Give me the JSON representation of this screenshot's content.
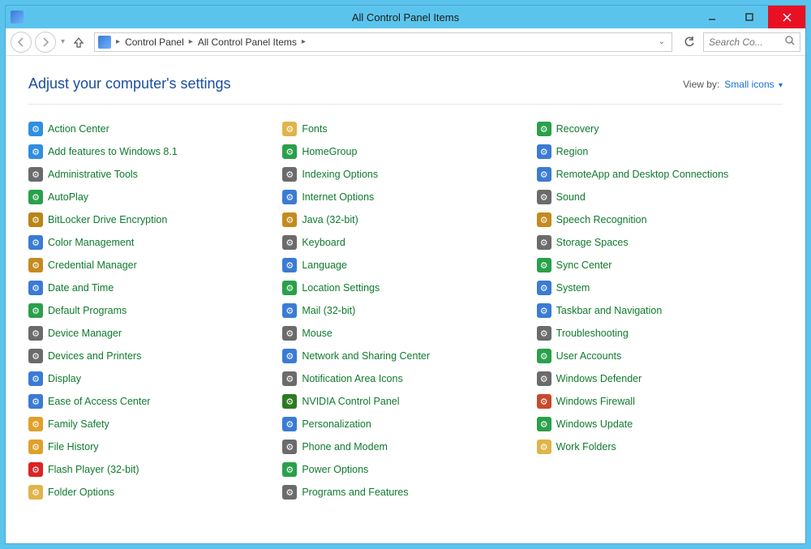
{
  "window": {
    "title": "All Control Panel Items"
  },
  "nav": {
    "breadcrumb": [
      "Control Panel",
      "All Control Panel Items"
    ],
    "search_placeholder": "Search Co..."
  },
  "header": {
    "subtitle": "Adjust your computer's settings",
    "viewby_label": "View by:",
    "viewby_value": "Small icons"
  },
  "items": [
    {
      "label": "Action Center",
      "icon": "flag-icon",
      "bg": "#2f8fe0"
    },
    {
      "label": "Add features to Windows 8.1",
      "icon": "windows-icon",
      "bg": "#2f8fe0"
    },
    {
      "label": "Administrative Tools",
      "icon": "tools-icon",
      "bg": "#6b6b6b"
    },
    {
      "label": "AutoPlay",
      "icon": "autoplay-icon",
      "bg": "#2aa04a"
    },
    {
      "label": "BitLocker Drive Encryption",
      "icon": "lock-icon",
      "bg": "#b88516"
    },
    {
      "label": "Color Management",
      "icon": "color-icon",
      "bg": "#3a7bd5"
    },
    {
      "label": "Credential Manager",
      "icon": "safe-icon",
      "bg": "#c58a1e"
    },
    {
      "label": "Date and Time",
      "icon": "clock-icon",
      "bg": "#3a7bd5"
    },
    {
      "label": "Default Programs",
      "icon": "defaults-icon",
      "bg": "#2aa04a"
    },
    {
      "label": "Device Manager",
      "icon": "device-icon",
      "bg": "#6b6b6b"
    },
    {
      "label": "Devices and Printers",
      "icon": "printer-icon",
      "bg": "#6b6b6b"
    },
    {
      "label": "Display",
      "icon": "display-icon",
      "bg": "#3a7bd5"
    },
    {
      "label": "Ease of Access Center",
      "icon": "ease-icon",
      "bg": "#3a7bd5"
    },
    {
      "label": "Family Safety",
      "icon": "family-icon",
      "bg": "#e0a02a"
    },
    {
      "label": "File History",
      "icon": "history-icon",
      "bg": "#e0a02a"
    },
    {
      "label": "Flash Player (32-bit)",
      "icon": "flash-icon",
      "bg": "#d22"
    },
    {
      "label": "Folder Options",
      "icon": "folder-icon",
      "bg": "#e0b44a"
    },
    {
      "label": "Fonts",
      "icon": "fonts-icon",
      "bg": "#e0b44a"
    },
    {
      "label": "HomeGroup",
      "icon": "homegroup-icon",
      "bg": "#2aa04a"
    },
    {
      "label": "Indexing Options",
      "icon": "index-icon",
      "bg": "#6b6b6b"
    },
    {
      "label": "Internet Options",
      "icon": "internet-icon",
      "bg": "#3a7bd5"
    },
    {
      "label": "Java (32-bit)",
      "icon": "java-icon",
      "bg": "#c58a1e"
    },
    {
      "label": "Keyboard",
      "icon": "keyboard-icon",
      "bg": "#6b6b6b"
    },
    {
      "label": "Language",
      "icon": "language-icon",
      "bg": "#3a7bd5"
    },
    {
      "label": "Location Settings",
      "icon": "location-icon",
      "bg": "#2aa04a"
    },
    {
      "label": "Mail (32-bit)",
      "icon": "mail-icon",
      "bg": "#3a7bd5"
    },
    {
      "label": "Mouse",
      "icon": "mouse-icon",
      "bg": "#6b6b6b"
    },
    {
      "label": "Network and Sharing Center",
      "icon": "network-icon",
      "bg": "#3a7bd5"
    },
    {
      "label": "Notification Area Icons",
      "icon": "tray-icon",
      "bg": "#6b6b6b"
    },
    {
      "label": "NVIDIA Control Panel",
      "icon": "nvidia-icon",
      "bg": "#2d7a22"
    },
    {
      "label": "Personalization",
      "icon": "personalize-icon",
      "bg": "#3a7bd5"
    },
    {
      "label": "Phone and Modem",
      "icon": "phone-icon",
      "bg": "#6b6b6b"
    },
    {
      "label": "Power Options",
      "icon": "power-icon",
      "bg": "#2aa04a"
    },
    {
      "label": "Programs and Features",
      "icon": "programs-icon",
      "bg": "#6b6b6b"
    },
    {
      "label": "Recovery",
      "icon": "recovery-icon",
      "bg": "#2aa04a"
    },
    {
      "label": "Region",
      "icon": "region-icon",
      "bg": "#3a7bd5"
    },
    {
      "label": "RemoteApp and Desktop Connections",
      "icon": "remote-icon",
      "bg": "#3a7bd5"
    },
    {
      "label": "Sound",
      "icon": "sound-icon",
      "bg": "#6b6b6b"
    },
    {
      "label": "Speech Recognition",
      "icon": "speech-icon",
      "bg": "#c58a1e"
    },
    {
      "label": "Storage Spaces",
      "icon": "storage-icon",
      "bg": "#6b6b6b"
    },
    {
      "label": "Sync Center",
      "icon": "sync-icon",
      "bg": "#2aa04a"
    },
    {
      "label": "System",
      "icon": "system-icon",
      "bg": "#3a7bd5"
    },
    {
      "label": "Taskbar and Navigation",
      "icon": "taskbar-icon",
      "bg": "#3a7bd5"
    },
    {
      "label": "Troubleshooting",
      "icon": "troubleshoot-icon",
      "bg": "#6b6b6b"
    },
    {
      "label": "User Accounts",
      "icon": "users-icon",
      "bg": "#2aa04a"
    },
    {
      "label": "Windows Defender",
      "icon": "defender-icon",
      "bg": "#6b6b6b"
    },
    {
      "label": "Windows Firewall",
      "icon": "firewall-icon",
      "bg": "#c94a2a"
    },
    {
      "label": "Windows Update",
      "icon": "update-icon",
      "bg": "#2aa04a"
    },
    {
      "label": "Work Folders",
      "icon": "workfolders-icon",
      "bg": "#e0b44a"
    }
  ]
}
